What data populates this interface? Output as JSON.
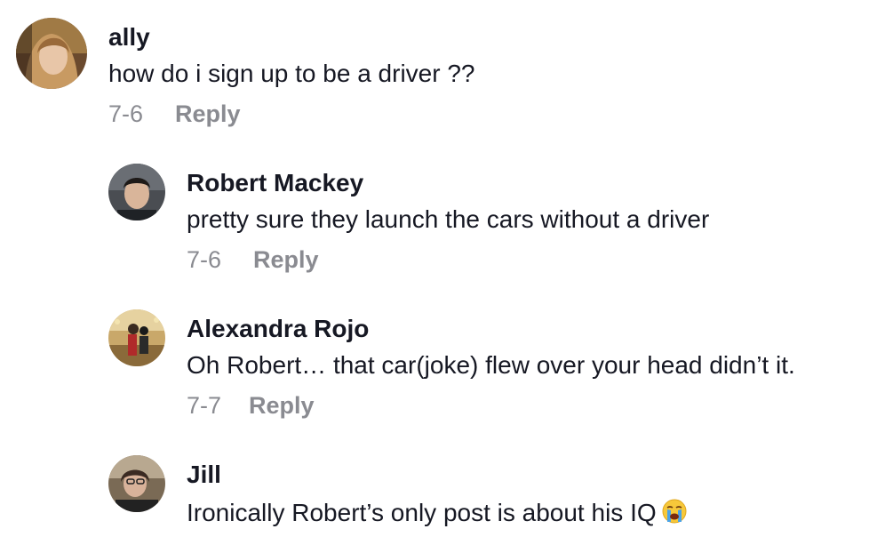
{
  "comments": [
    {
      "username": "ally",
      "text": "how do i sign up to be a driver ??",
      "date": "7-6",
      "reply_label": "Reply",
      "avatar": "user-photo"
    },
    {
      "username": "Robert Mackey",
      "text": "pretty sure they launch the cars without a driver",
      "date": "7-6",
      "reply_label": "Reply",
      "avatar": "user-photo"
    },
    {
      "username": "Alexandra Rojo",
      "text": "Oh Robert… that car(joke) flew over your head didn’t it.",
      "date": "7-7",
      "reply_label": "Reply",
      "avatar": "user-photo"
    },
    {
      "username": "Jill",
      "text": "Ironically Robert’s only post is about his IQ",
      "emoji": "loudly-crying-face-emoji",
      "avatar": "user-photo"
    }
  ],
  "colors": {
    "name": "#161823",
    "text": "#161823",
    "meta": "#8a8b91"
  }
}
